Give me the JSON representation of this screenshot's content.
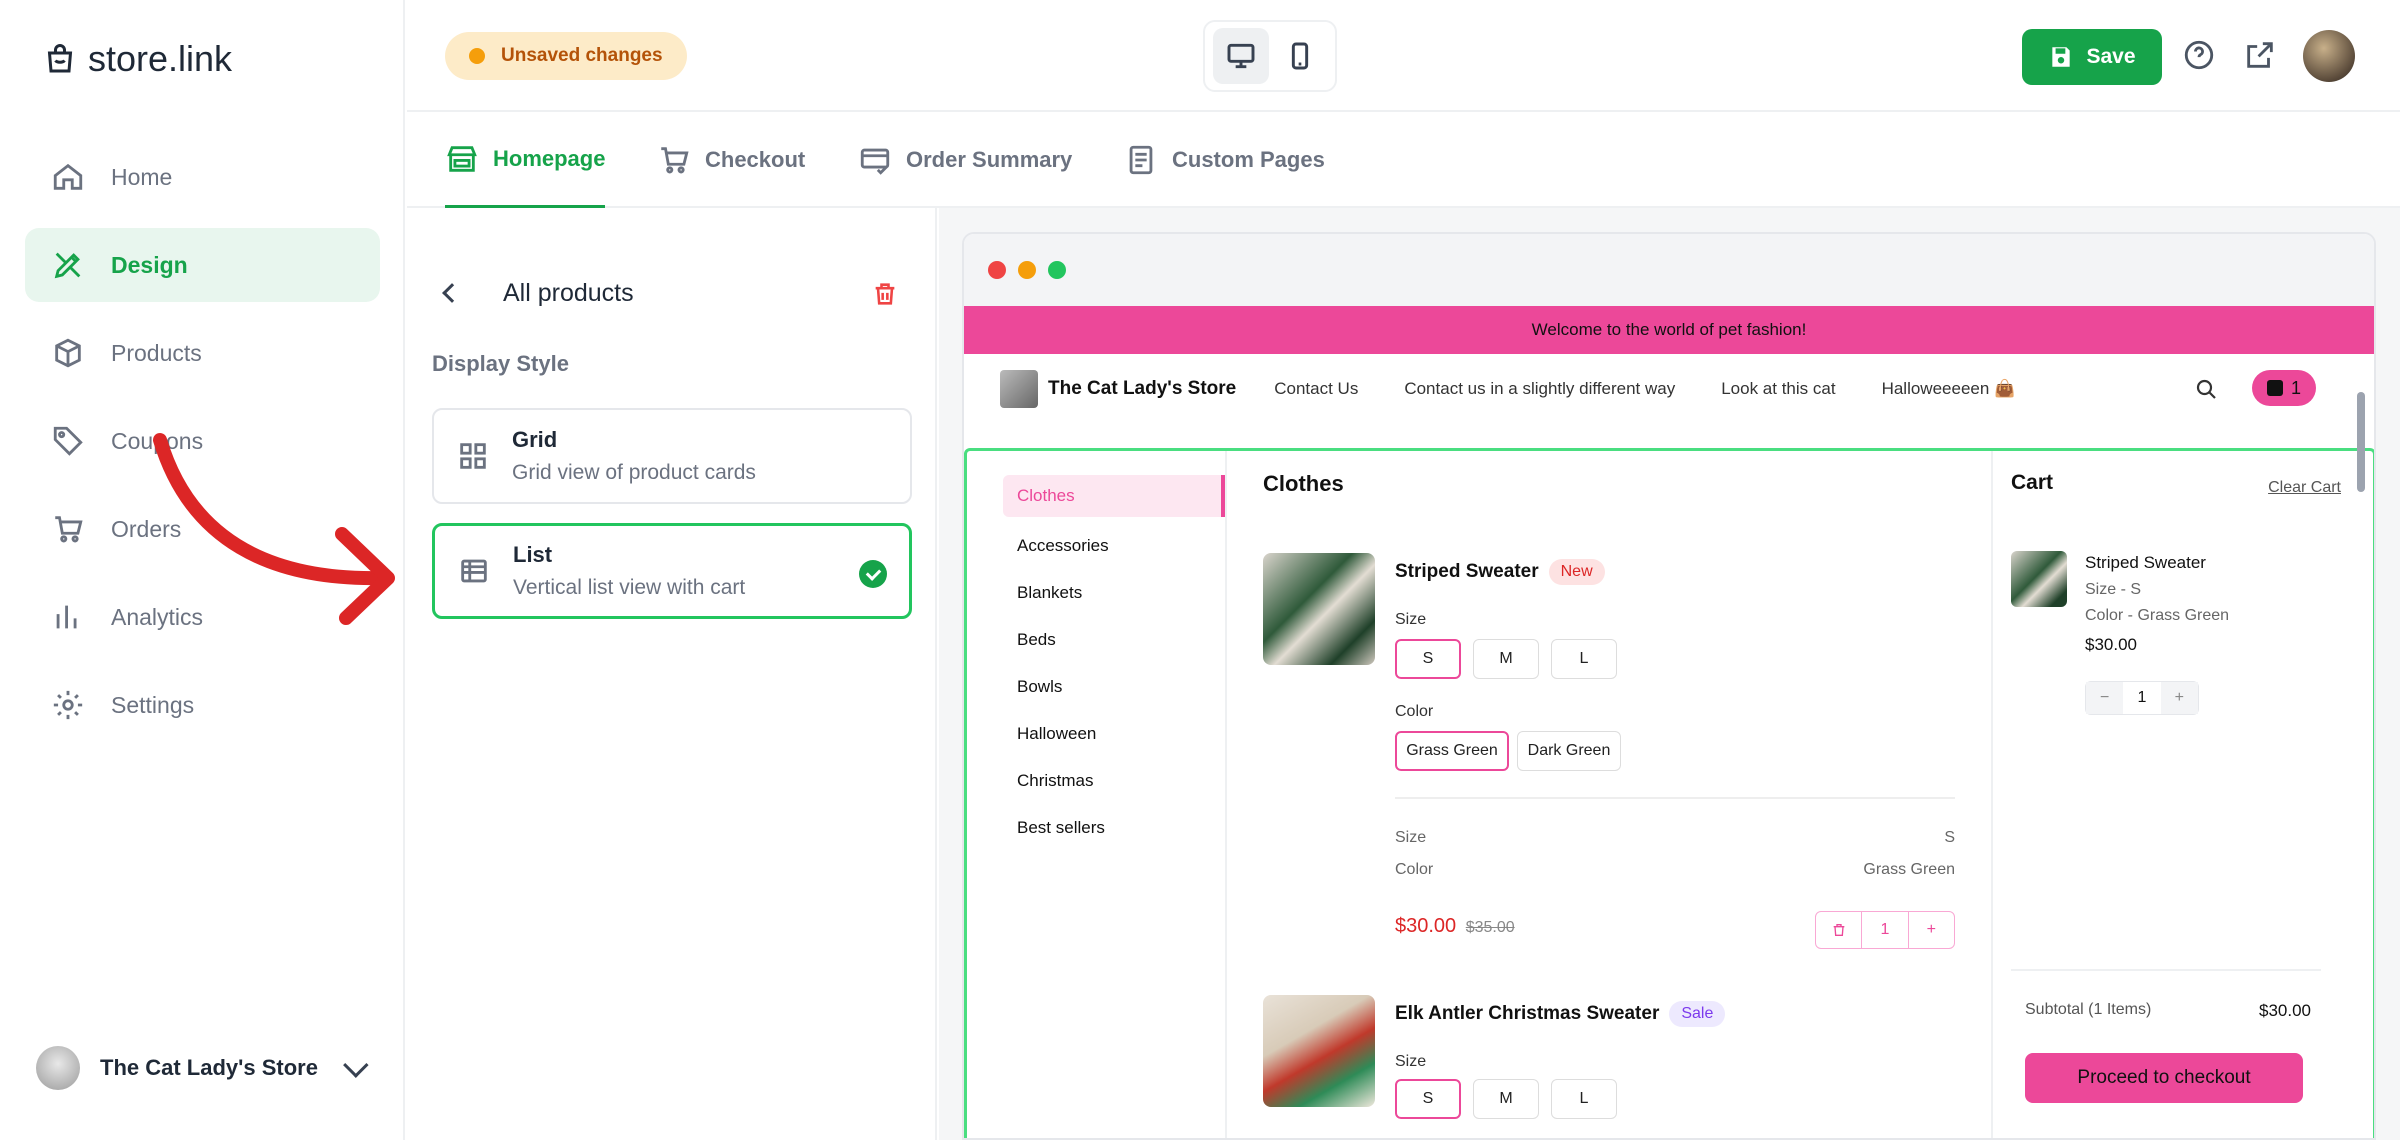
{
  "app": {
    "name": "store.link"
  },
  "sidebar": {
    "items": [
      {
        "label": "Home",
        "icon": "home-icon"
      },
      {
        "label": "Design",
        "icon": "design-icon",
        "active": true
      },
      {
        "label": "Products",
        "icon": "box-icon"
      },
      {
        "label": "Coupons",
        "icon": "tag-icon"
      },
      {
        "label": "Orders",
        "icon": "cart-icon"
      },
      {
        "label": "Analytics",
        "icon": "chart-icon"
      },
      {
        "label": "Settings",
        "icon": "gear-icon"
      }
    ],
    "store_name": "The Cat Lady's Store"
  },
  "topbar": {
    "status": "Unsaved changes",
    "save_label": "Save"
  },
  "tabs": [
    {
      "label": "Homepage",
      "active": true
    },
    {
      "label": "Checkout"
    },
    {
      "label": "Order Summary"
    },
    {
      "label": "Custom Pages"
    }
  ],
  "panel": {
    "title": "All products",
    "section_label": "Display Style",
    "options": [
      {
        "title": "Grid",
        "desc": "Grid view of product cards"
      },
      {
        "title": "List",
        "desc": "Vertical list view with cart",
        "selected": true
      }
    ]
  },
  "preview": {
    "banner": "Welcome to the world of pet fashion!",
    "store_name": "The Cat Lady's Store",
    "nav_links": [
      "Contact Us",
      "Contact us in a slightly different way",
      "Look at this cat",
      "Halloweeeeen 👜"
    ],
    "cart_count": "1",
    "categories": [
      "Clothes",
      "Accessories",
      "Blankets",
      "Beds",
      "Bowls",
      "Halloween",
      "Christmas",
      "Best sellers"
    ],
    "category_title": "Clothes",
    "products": [
      {
        "name": "Striped Sweater",
        "badge": "New",
        "size_label": "Size",
        "sizes": [
          "S",
          "M",
          "L"
        ],
        "color_label": "Color",
        "colors": [
          "Grass Green",
          "Dark Green"
        ],
        "summary_size_label": "Size",
        "summary_size": "S",
        "summary_color_label": "Color",
        "summary_color": "Grass Green",
        "price": "$30.00",
        "old_price": "$35.00",
        "qty": "1"
      },
      {
        "name": "Elk Antler Christmas Sweater",
        "badge": "Sale",
        "size_label": "Size",
        "sizes": [
          "S",
          "M",
          "L"
        ]
      }
    ],
    "cart": {
      "title": "Cart",
      "clear": "Clear Cart",
      "item_name": "Striped Sweater",
      "item_size": "Size - S",
      "item_color": "Color - Grass Green",
      "item_price": "$30.00",
      "qty": "1",
      "subtotal_label": "Subtotal (1 Items)",
      "subtotal": "$30.00",
      "checkout": "Proceed to checkout"
    }
  },
  "colors": {
    "accent": "#16a34a",
    "brand_pink": "#ec4899",
    "annotation_arrow": "#dc2626"
  }
}
